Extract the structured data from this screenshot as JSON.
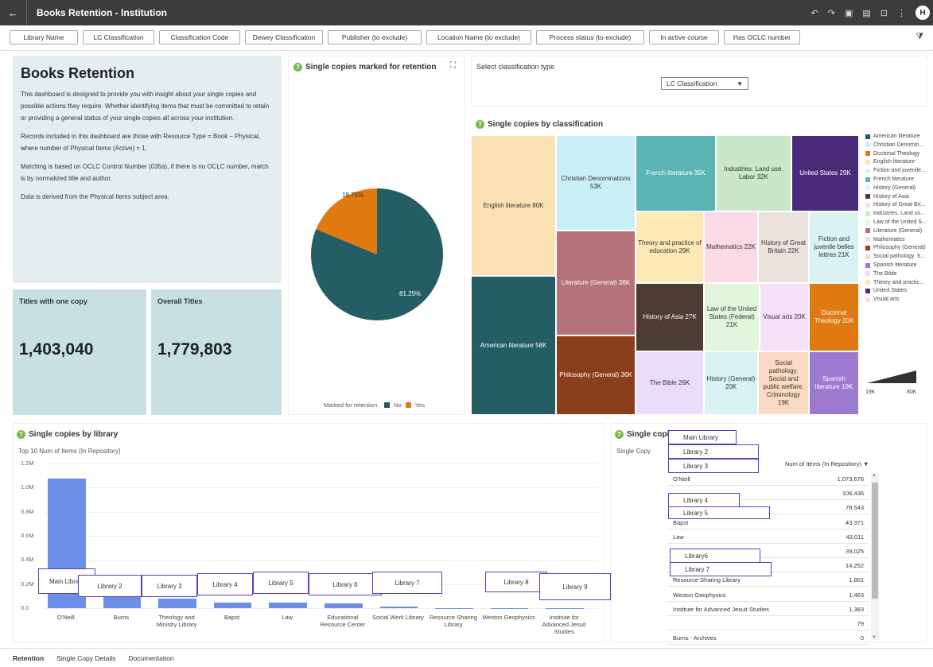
{
  "app": {
    "title": "Books Retention - Institution",
    "avatar": "H"
  },
  "filters": [
    "Library Name",
    "LC Classification",
    "Classification Code",
    "Dewey Classification",
    "Publisher (to exclude)",
    "Location Name (to exclude)",
    "Process status (to exclude)",
    "In active course",
    "Has OCLC number"
  ],
  "description": {
    "heading": "Books Retention",
    "paragraphs": [
      "This dashboard is designed to provide you with insight about your single copies and possible actions they require. Whether identifying items that must be committed to retain or providing a general status of your single copies all across your institution.",
      "Records included in this dashboard are those with Resource Type = Book – Physical, where number of Physical Items (Active) = 1.",
      "Matching is based on OCLC Control Number (035a), if there is no OCLC number, match is by normalized title and author.",
      "Data is derived from the Physical Items subject area."
    ]
  },
  "kpis": {
    "titles_one_copy": {
      "label": "Titles with one copy",
      "value": "1,403,040"
    },
    "overall_titles": {
      "label": "Overall Titles",
      "value": "1,779,803"
    }
  },
  "pie": {
    "title": "Single copies marked for retention",
    "legend_title": "Marked for retention",
    "no_label": "No",
    "yes_label": "Yes",
    "no_pct": "81.25%",
    "yes_pct": "18.75%",
    "no_color": "#245d63",
    "yes_color": "#e07a10"
  },
  "classification_select": {
    "label": "Select classification type",
    "value": "LC Classification"
  },
  "treemap": {
    "title": "Single copies by classification",
    "cells": [
      {
        "label": "English literature 80K",
        "color": "#fce2b3",
        "dark": false
      },
      {
        "label": "American literature 58K",
        "color": "#245d63",
        "dark": true
      },
      {
        "label": "Christian Denominations 53K",
        "color": "#c9eff5",
        "dark": false
      },
      {
        "label": "Literature (General) 38K",
        "color": "#b5727a",
        "dark": true
      },
      {
        "label": "Philosophy (General) 36K",
        "color": "#8b3e1c",
        "dark": true
      },
      {
        "label": "French literature 35K",
        "color": "#5bb5b5",
        "dark": true
      },
      {
        "label": "Industries. Land use. Labor 32K",
        "color": "#c8e8c8",
        "dark": false
      },
      {
        "label": "United States 29K",
        "color": "#4a2b7a",
        "dark": true
      },
      {
        "label": "Theory and practice of education 29K",
        "color": "#fce9b5",
        "dark": false
      },
      {
        "label": "Mathematics 22K",
        "color": "#fbd9e6",
        "dark": false
      },
      {
        "label": "History of Great Britain 22K",
        "color": "#ece2dd",
        "dark": false
      },
      {
        "label": "Fiction and juvenile belles lettres 21K",
        "color": "#d9f3f3",
        "dark": false
      },
      {
        "label": "History of Asia 27K",
        "color": "#4d3c33",
        "dark": true
      },
      {
        "label": "Law of the United States (Federal) 21K",
        "color": "#e2f5dd",
        "dark": false
      },
      {
        "label": "Visual arts 20K",
        "color": "#f3e2f7",
        "dark": false
      },
      {
        "label": "Doctrinal Theology 20K",
        "color": "#e07a10",
        "dark": true
      },
      {
        "label": "The Bible 26K",
        "color": "#e9ddfb",
        "dark": false
      },
      {
        "label": "History (General) 20K",
        "color": "#d9f3f3",
        "dark": false
      },
      {
        "label": "Social pathology. Social and public welfare. Criminology 19K",
        "color": "#fcd9c2",
        "dark": false
      },
      {
        "label": "Spanish literature 19K",
        "color": "#9b7ad0",
        "dark": true
      }
    ],
    "legend": [
      {
        "label": "American literature",
        "color": "#245d63"
      },
      {
        "label": "Christian Denomin...",
        "color": "#c9eff5"
      },
      {
        "label": "Doctrinal Theology",
        "color": "#e07a10"
      },
      {
        "label": "English literature",
        "color": "#fce2b3"
      },
      {
        "label": "Fiction and juvenile...",
        "color": "#d9f3f3"
      },
      {
        "label": "French literature",
        "color": "#5bb5b5"
      },
      {
        "label": "History (General)",
        "color": "#d9f3f3"
      },
      {
        "label": "History of Asia",
        "color": "#4d3c33"
      },
      {
        "label": "History of Great Bri...",
        "color": "#ece2dd"
      },
      {
        "label": "Industries. Land us...",
        "color": "#c8e8c8"
      },
      {
        "label": "Law of the United S...",
        "color": "#e2f5dd"
      },
      {
        "label": "Literature (General)",
        "color": "#b5727a"
      },
      {
        "label": "Mathematics",
        "color": "#fbd9e6"
      },
      {
        "label": "Philosophy (General)",
        "color": "#8b3e1c"
      },
      {
        "label": "Social pathology. S...",
        "color": "#fcd9c2"
      },
      {
        "label": "Spanish literature",
        "color": "#9b7ad0"
      },
      {
        "label": "The Bible",
        "color": "#e9ddfb"
      },
      {
        "label": "Theory and practic...",
        "color": "#fce9b5"
      },
      {
        "label": "United States",
        "color": "#4a2b7a"
      },
      {
        "label": "Visual arts",
        "color": "#f3e2f7"
      }
    ],
    "scale_min": "19K",
    "scale_max": "80K"
  },
  "bar_panel": {
    "title": "Single copies by library",
    "subtitle": "Top 10 Num of Items (In Repository)",
    "overlay_labels": [
      "Main Library",
      "Library 2",
      "Library 3",
      "Library 4",
      "Library 5",
      "Library 6",
      "Library 7",
      "Library 8",
      "Library 9"
    ]
  },
  "chart_data": {
    "type": "bar",
    "title": "Single copies by library",
    "ylabel": "Top 10 Num of Items (In Repository)",
    "categories": [
      "O'Neill",
      "Burns",
      "Theology and Ministry Library",
      "Bapst",
      "Law",
      "Educational Resource Center",
      "Social Work Library",
      "Resource Sharing Library",
      "Weston Geophysics",
      "Institute for Advanced Jesuit Studies"
    ],
    "values": [
      1073676,
      106436,
      78543,
      43371,
      43011,
      39025,
      14252,
      1801,
      1463,
      1383
    ],
    "ylim": [
      0,
      1200000
    ],
    "yticks": [
      "0.0",
      "0.2M",
      "0.4M",
      "0.6M",
      "0.8M",
      "1.0M",
      "1.2M"
    ],
    "color": "#6b8ee8"
  },
  "table_panel": {
    "title": "Single copie",
    "row_header": "Single Copy",
    "col_header": "Num of Items (In Repository)",
    "rows": [
      {
        "name": "O'Neill",
        "value": "1,073,676"
      },
      {
        "name": "",
        "value": "106,436"
      },
      {
        "name": "",
        "value": "78,543"
      },
      {
        "name": "Bapst",
        "value": "43,371"
      },
      {
        "name": "Law",
        "value": "43,011"
      },
      {
        "name": "",
        "value": "39,025"
      },
      {
        "name": "",
        "value": "14,252"
      },
      {
        "name": "Resource Sharing Library",
        "value": "1,801"
      },
      {
        "name": "Weston Geophysics",
        "value": "1,463"
      },
      {
        "name": "Institute for Advanced Jesuit Studies",
        "value": "1,383"
      },
      {
        "name": "",
        "value": "79"
      },
      {
        "name": "Burns - Archives",
        "value": "0"
      }
    ],
    "overlay_labels": [
      "Main Library",
      "Library 2",
      "Library 3",
      "Library 4",
      "Library 5",
      "Library6",
      "Library 7"
    ]
  },
  "tabs": [
    "Retention",
    "Single Copy Details",
    "Documentation"
  ]
}
